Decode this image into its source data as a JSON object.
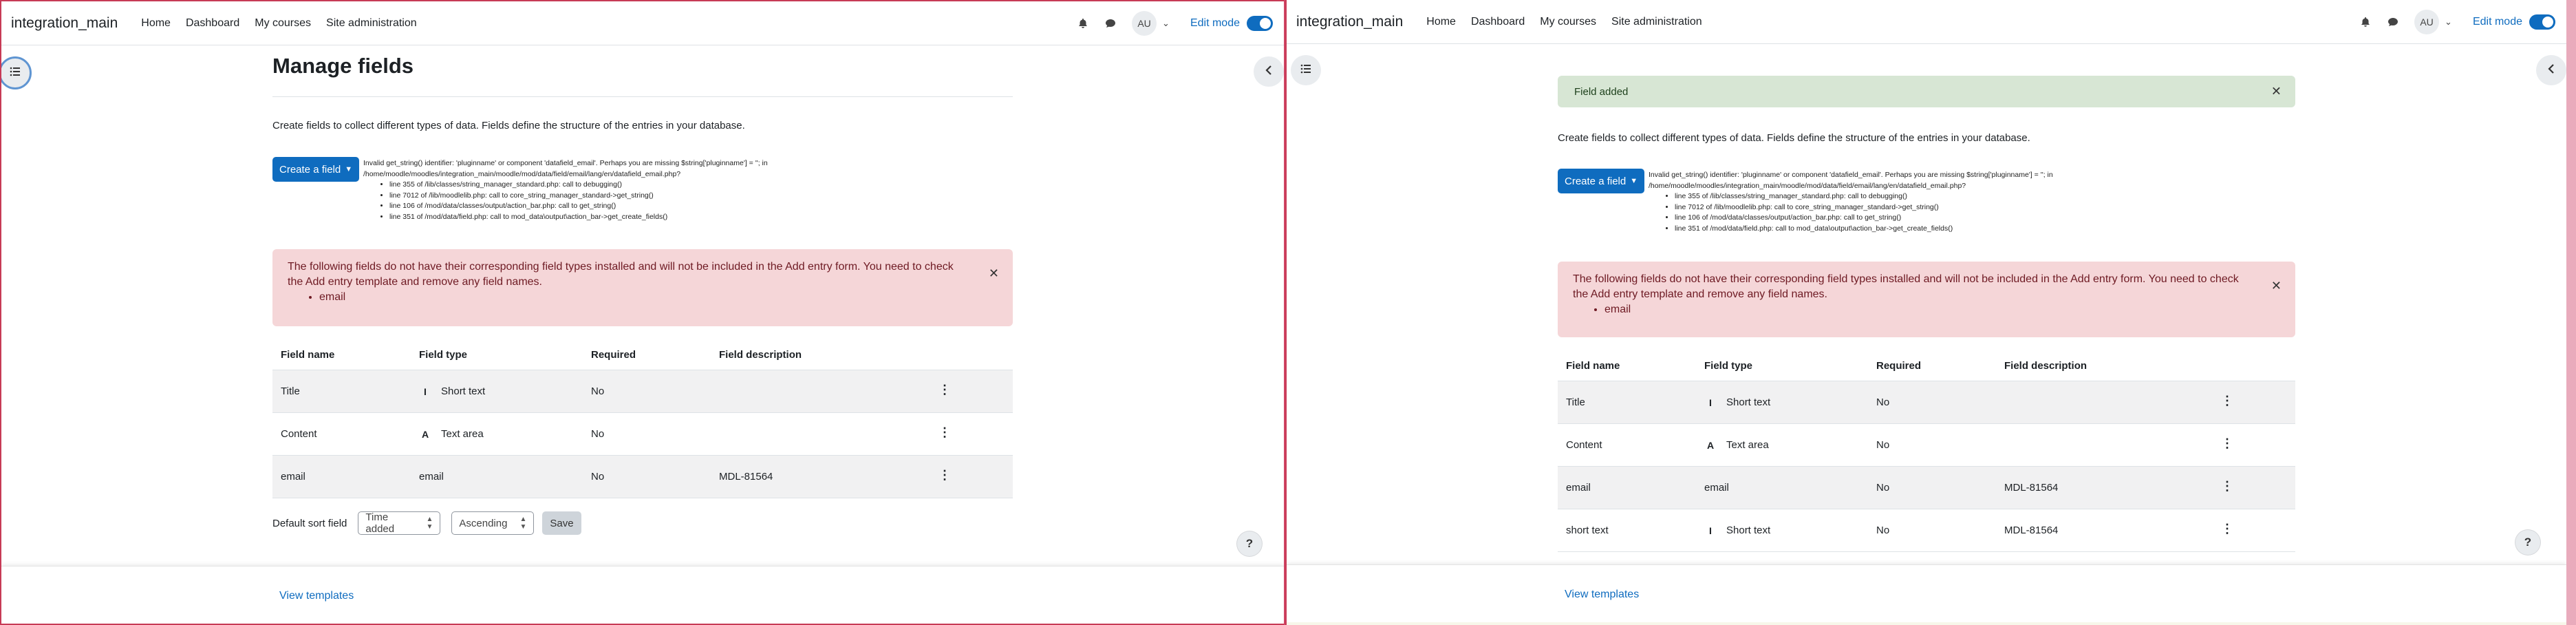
{
  "colors": {
    "accent": "#0f6cbf",
    "danger_bg": "#f5d6d8",
    "success_bg": "#d7e6d4",
    "divider": "#d04666"
  },
  "navbar": {
    "site_name": "integration_main",
    "links": [
      "Home",
      "Dashboard",
      "My courses",
      "Site administration"
    ],
    "avatar_initials": "AU",
    "edit_mode_label": "Edit mode",
    "icons": [
      "bell-icon",
      "chat-icon"
    ]
  },
  "page": {
    "title": "Manage fields",
    "intro": "Create fields to collect different types of data. Fields define the structure of the entries in your database.",
    "create_field_label": "Create a field",
    "debug": {
      "message": "Invalid get_string() identifier: 'pluginname' or component 'datafield_email'. Perhaps you are missing $string['pluginname'] = ''; in /home/moodle/moodles/integration_main/moodle/mod/data/field/email/lang/en/datafield_email.php?",
      "trace": [
        "line 355 of /lib/classes/string_manager_standard.php: call to debugging()",
        "line 7012 of /lib/moodlelib.php: call to core_string_manager_standard->get_string()",
        "line 106 of /mod/data/classes/output/action_bar.php: call to get_string()",
        "line 351 of /mod/data/field.php: call to mod_data\\output\\action_bar->get_create_fields()"
      ]
    },
    "danger_alert": {
      "text": "The following fields do not have their corresponding field types installed and will not be included in the Add entry form. You need to check the Add entry template and remove any field names.",
      "items": [
        "email"
      ]
    },
    "success_alert": "Field added",
    "table": {
      "headers": [
        "Field name",
        "Field type",
        "Required",
        "Field description"
      ],
      "rows_left": [
        {
          "name": "Title",
          "type": "Short text",
          "type_icon": "I",
          "required": "No",
          "description": ""
        },
        {
          "name": "Content",
          "type": "Text area",
          "type_icon": "A",
          "required": "No",
          "description": ""
        },
        {
          "name": "email",
          "type": "email",
          "type_icon": "",
          "required": "No",
          "description": "MDL-81564"
        }
      ],
      "rows_right": [
        {
          "name": "Title",
          "type": "Short text",
          "type_icon": "I",
          "required": "No",
          "description": ""
        },
        {
          "name": "Content",
          "type": "Text area",
          "type_icon": "A",
          "required": "No",
          "description": ""
        },
        {
          "name": "email",
          "type": "email",
          "type_icon": "",
          "required": "No",
          "description": "MDL-81564"
        },
        {
          "name": "short text",
          "type": "Short text",
          "type_icon": "I",
          "required": "No",
          "description": "MDL-81564"
        }
      ]
    },
    "sort": {
      "label": "Default sort field",
      "field_value": "Time added",
      "order_value": "Ascending",
      "save_label": "Save"
    },
    "help_label": "?",
    "view_templates": "View templates"
  }
}
